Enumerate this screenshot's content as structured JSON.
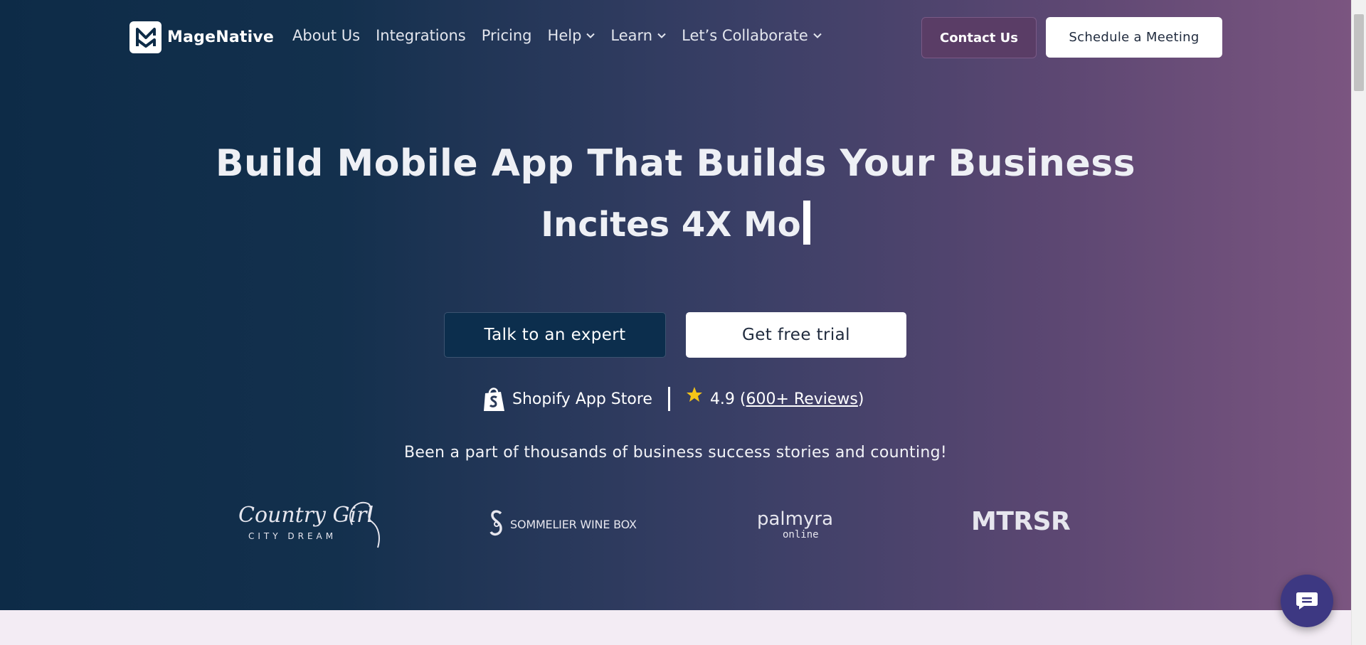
{
  "header": {
    "brand": "MageNative",
    "nav": [
      {
        "label": "About Us",
        "dropdown": false
      },
      {
        "label": "Integrations",
        "dropdown": false
      },
      {
        "label": "Pricing",
        "dropdown": false
      },
      {
        "label": "Help",
        "dropdown": true
      },
      {
        "label": "Learn",
        "dropdown": true
      },
      {
        "label": "Let’s Collaborate",
        "dropdown": true
      }
    ],
    "contact_label": "Contact Us",
    "schedule_label": "Schedule a Meeting"
  },
  "hero": {
    "headline": "Build Mobile App That Builds Your Business",
    "typing_text": "Incites 4X Mo",
    "expert_button": "Talk to an expert",
    "trial_button": "Get free trial",
    "shopify_label": "Shopify App Store",
    "rating": "4.9",
    "reviews_link": "600+ Reviews",
    "tagline": "Been a part of thousands of business success stories and counting!"
  },
  "brands": {
    "country_girl": {
      "line1": "Country Girl",
      "line2": "CITY DREAM"
    },
    "sommelier": "SOMMELIER WINE BOX",
    "palmyra": {
      "line1": "palmyra",
      "line2": "online"
    },
    "motorsr": "MTRSR"
  },
  "colors": {
    "gradient_start": "#0d2b47",
    "gradient_end": "#7b5580",
    "contact_button": "#5a3d66",
    "expert_button": "#0c2e4d",
    "star": "#f5c518",
    "chat_button": "#3d3882"
  }
}
